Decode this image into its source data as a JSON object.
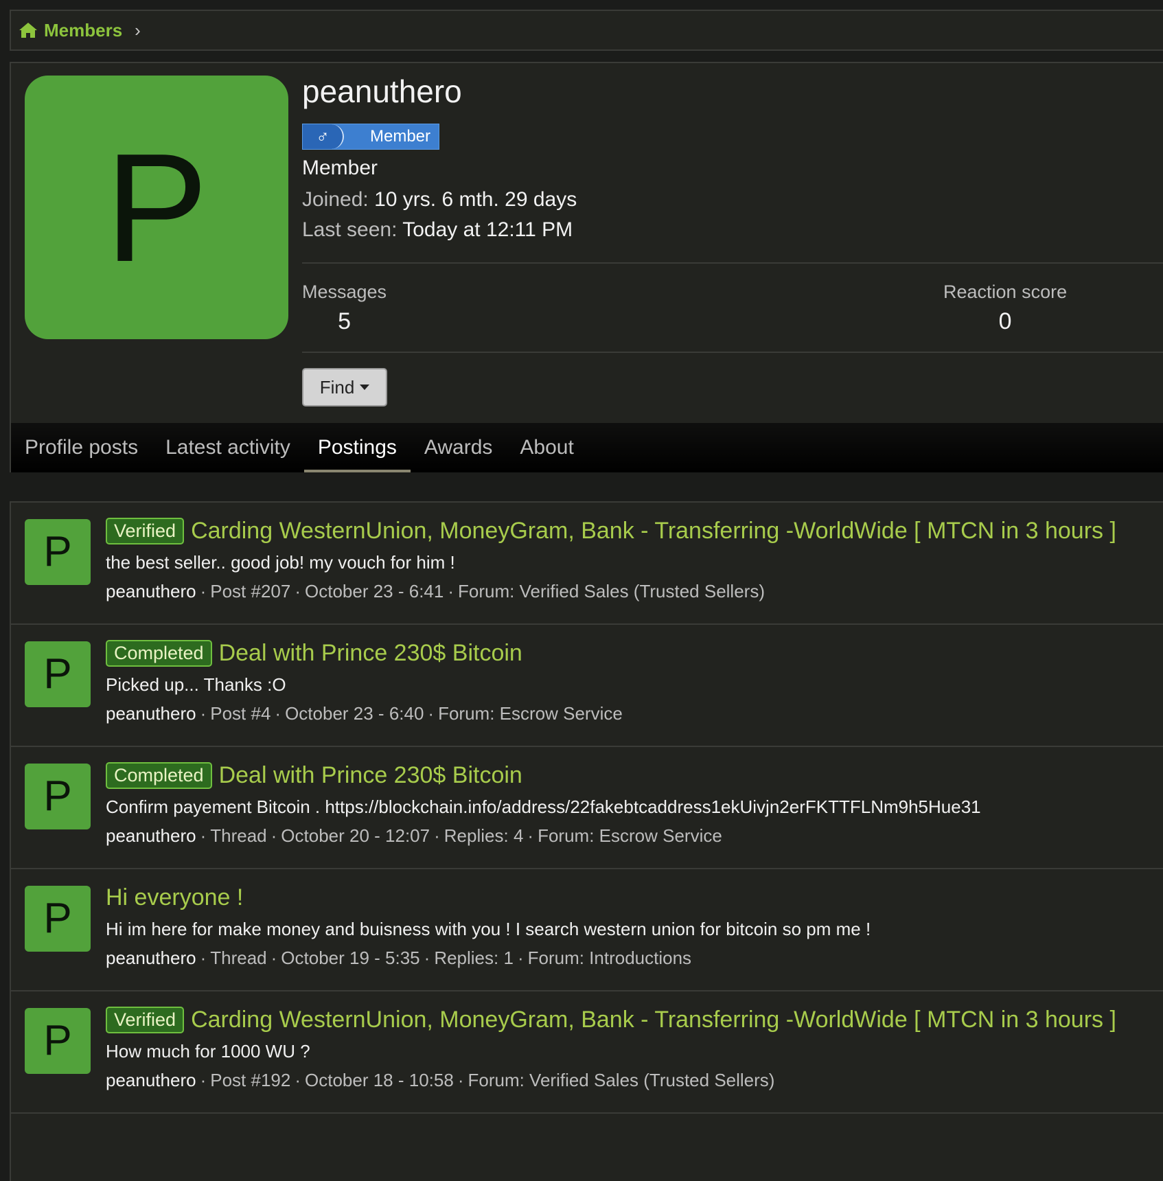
{
  "breadcrumb": {
    "label": "Members"
  },
  "profile": {
    "avatar_letter": "P",
    "username": "peanuthero",
    "banner_symbol": "♂",
    "banner_text": "Member",
    "role": "Member",
    "joined_label": "Joined:",
    "joined_value": "10 yrs. 6 mth. 29 days",
    "last_seen_label": "Last seen:",
    "last_seen_value": "Today at 12:11 PM",
    "messages_label": "Messages",
    "messages_value": "5",
    "reaction_label": "Reaction score",
    "reaction_value": "0",
    "find_label": "Find"
  },
  "tabs": [
    "Profile posts",
    "Latest activity",
    "Postings",
    "Awards",
    "About"
  ],
  "active_tab": "Postings",
  "colors": {
    "accent": "#a8cc4c",
    "avatar": "#52a23b",
    "banner": "#3d7fd0"
  },
  "items": [
    {
      "avatar": "P",
      "prefix": "Verified",
      "title": "Carding WesternUnion, MoneyGram, Bank - Transferring -WorldWide [ MTCN in 3 hours ]",
      "snippet": "the best seller.. good job! my vouch for him !",
      "user": "peanuthero",
      "meta": [
        "Post #207",
        "October 23 - 6:41",
        "Forum: Verified Sales (Trusted Sellers)"
      ]
    },
    {
      "avatar": "P",
      "prefix": "Completed",
      "title": "Deal with Prince 230$ Bitcoin",
      "snippet": "Picked up... Thanks :O",
      "user": "peanuthero",
      "meta": [
        "Post #4",
        "October 23 - 6:40",
        "Forum: Escrow Service"
      ]
    },
    {
      "avatar": "P",
      "prefix": "Completed",
      "title": "Deal with Prince 230$ Bitcoin",
      "snippet": "Confirm payement Bitcoin . https://blockchain.info/address/22fakebtcaddress1ekUivjn2erFKTTFLNm9h5Hue31",
      "user": "peanuthero",
      "meta": [
        "Thread",
        "October 20 - 12:07",
        "Replies: 4",
        "Forum: Escrow Service"
      ]
    },
    {
      "avatar": "P",
      "prefix": "",
      "title": "Hi everyone !",
      "snippet": "Hi im here for make money and buisness with you ! I search western union for bitcoin so pm me !",
      "user": "peanuthero",
      "meta": [
        "Thread",
        "October 19 - 5:35",
        "Replies: 1",
        "Forum: Introductions"
      ]
    },
    {
      "avatar": "P",
      "prefix": "Verified",
      "title": "Carding WesternUnion, MoneyGram, Bank - Transferring -WorldWide [ MTCN in 3 hours ]",
      "snippet": "How much for 1000 WU ?",
      "user": "peanuthero",
      "meta": [
        "Post #192",
        "October 18 - 10:58",
        "Forum: Verified Sales (Trusted Sellers)"
      ]
    }
  ]
}
